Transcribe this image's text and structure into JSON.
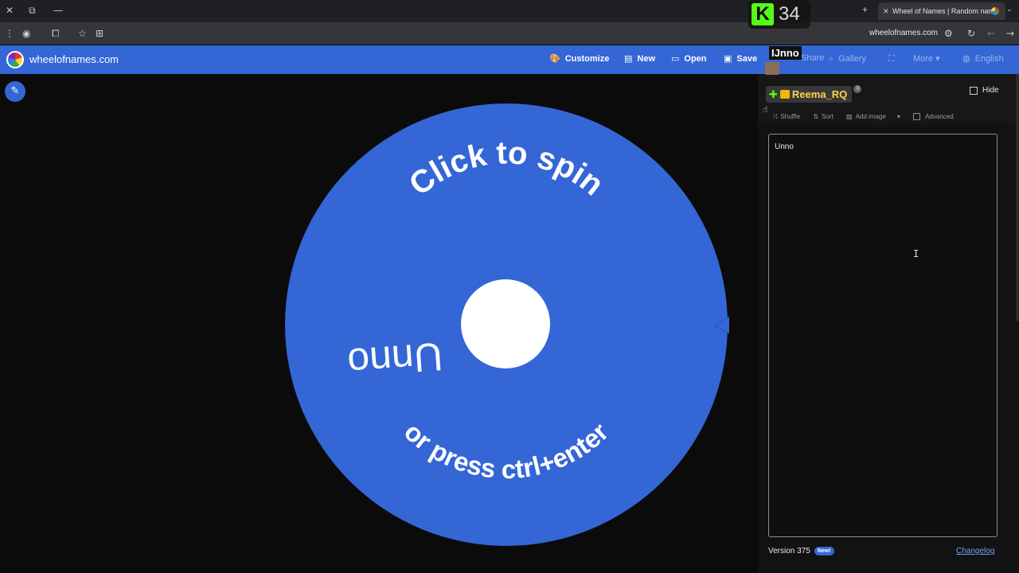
{
  "browser": {
    "tab_title": "Wheel of Names | Random nam",
    "url": "wheelofnames.com"
  },
  "header": {
    "site_name": "wheelofnames.com",
    "customize": "Customize",
    "new": "New",
    "open": "Open",
    "save": "Save",
    "share": "Share",
    "gallery": "Gallery",
    "more": "More",
    "language": "English"
  },
  "wheel": {
    "prompt_top": "Click to spin",
    "prompt_bottom": "or press ctrl+enter",
    "entry_label": "Unno",
    "color": "#3466d6"
  },
  "panel": {
    "hide_label": "Hide",
    "toolbar": {
      "shuffle": "Shuffle",
      "sort": "Sort",
      "add_image": "Add image",
      "advanced": "Advanced"
    },
    "entries_text": "Unno",
    "version": "Version 375",
    "new_badge": "New!",
    "changelog": "Changelog"
  },
  "overlay": {
    "kick_letter": "K",
    "viewer_count": "34",
    "viewer_name": "IJnno",
    "chat_user": "Reema_RQ",
    "chat_badge": "0"
  },
  "colors": {
    "brand_blue": "#3466d6",
    "kick_green": "#53fc18"
  },
  "icons": [
    "close-icon",
    "reload-icon",
    "minimize-icon",
    "star-icon",
    "pencil-icon",
    "palette-icon",
    "file-icon",
    "folder-icon",
    "save-icon",
    "search-icon",
    "fullscreen-icon",
    "globe-icon",
    "shuffle-icon",
    "sort-icon",
    "image-icon",
    "pointer-triangle-icon"
  ]
}
